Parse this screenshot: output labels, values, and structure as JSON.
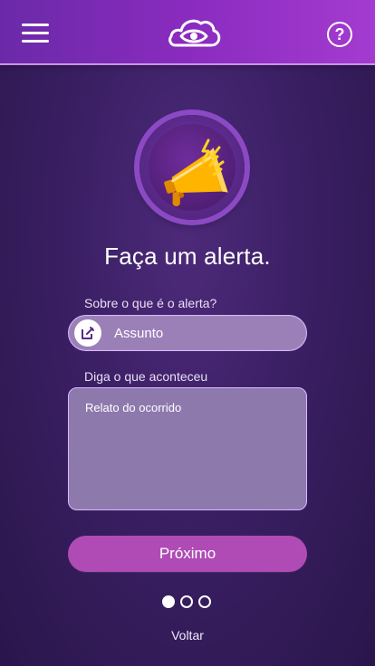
{
  "header": {
    "menu_icon": "hamburger-menu-icon",
    "logo_icon": "cloud-eye-logo",
    "help_icon": "question-icon",
    "help_symbol": "?"
  },
  "hero": {
    "icon": "megaphone-icon",
    "title": "Faça um alerta."
  },
  "form": {
    "subject_label": "Sobre o que é o alerta?",
    "subject_placeholder": "Assunto",
    "subject_icon": "edit-icon",
    "story_label": "Diga o que aconteceu",
    "story_placeholder": "Relato do ocorrido"
  },
  "actions": {
    "next_label": "Próximo",
    "back_label": "Voltar"
  },
  "pagination": {
    "current_step": 1,
    "total_steps": 3
  },
  "colors": {
    "header_start": "#6a2aa8",
    "header_end": "#a43bd0",
    "accent_button": "#b04bb6",
    "input_bg": "#9a80b7",
    "bg": "#3a1f63"
  }
}
